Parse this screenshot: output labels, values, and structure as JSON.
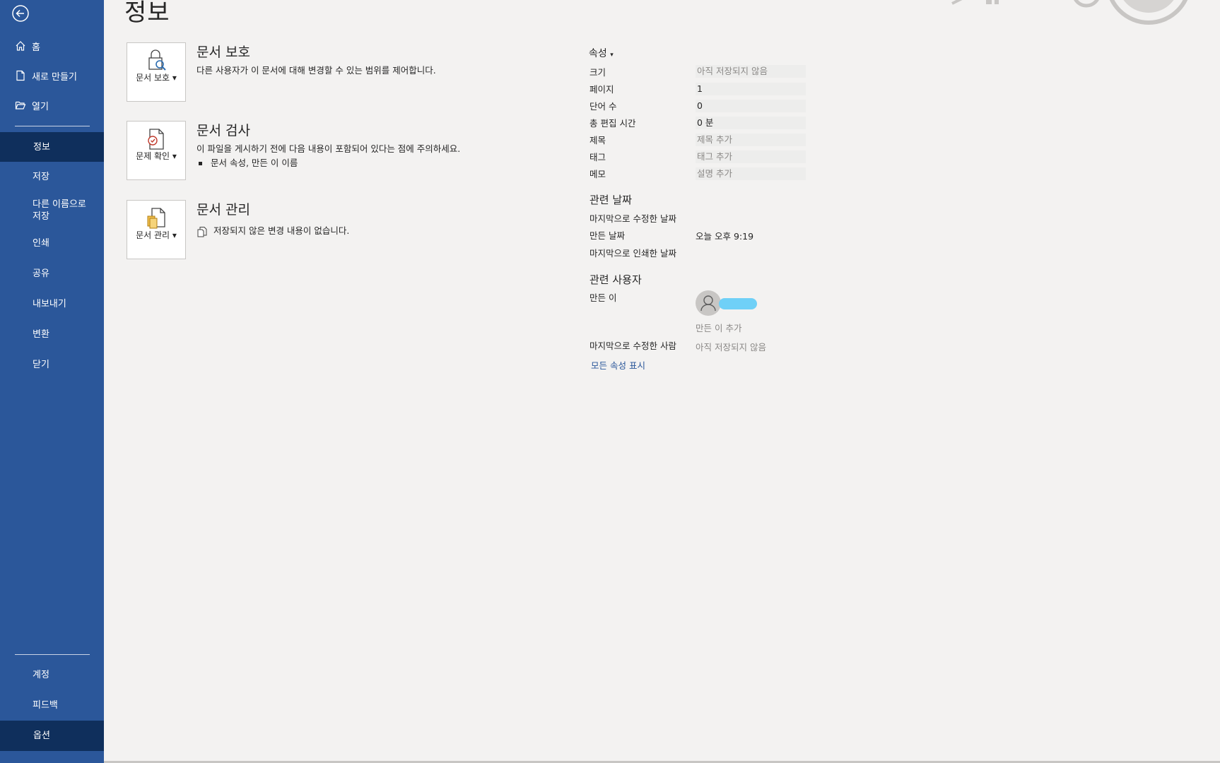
{
  "sidebar": {
    "top_items": [
      {
        "label": "홈",
        "icon": "home-icon"
      },
      {
        "label": "새로 만들기",
        "icon": "new-document-icon"
      },
      {
        "label": "열기",
        "icon": "open-folder-icon"
      }
    ],
    "items": [
      {
        "label": "정보",
        "selected": true
      },
      {
        "label": "저장"
      },
      {
        "label": "다른 이름으로 저장"
      },
      {
        "label": "인쇄"
      },
      {
        "label": "공유"
      },
      {
        "label": "내보내기"
      },
      {
        "label": "변환"
      },
      {
        "label": "닫기"
      }
    ],
    "bottom_items": [
      {
        "label": "계정"
      },
      {
        "label": "피드백"
      },
      {
        "label": "옵션",
        "selected": true
      }
    ],
    "colors": {
      "background": "#2b579a",
      "selected": "#0f2f5c"
    }
  },
  "main": {
    "title": "정보",
    "sections": [
      {
        "button_label": "문서 보호",
        "button_icon": "lock-document-icon",
        "title": "문서 보호",
        "description": "다른 사용자가 이 문서에 대해 변경할 수 있는 범위를 제어합니다."
      },
      {
        "button_label": "문제 확인",
        "button_icon": "check-document-icon",
        "title": "문서 검사",
        "description": "이 파일을 게시하기 전에 다음 내용이 포함되어 있다는 점에 주의하세요.",
        "bullets": [
          "문서 속성, 만든 이 이름"
        ]
      },
      {
        "button_label": "문서 관리",
        "button_icon": "manage-document-icon",
        "title": "문서 관리",
        "description": "저장되지 않은 변경 내용이 없습니다."
      }
    ]
  },
  "properties": {
    "header": "속성",
    "rows": [
      {
        "label": "크기",
        "value": "아직 저장되지 않음"
      },
      {
        "label": "페이지",
        "value": "1"
      },
      {
        "label": "단어 수",
        "value": "0"
      },
      {
        "label": "총 편집 시간",
        "value": "0 분"
      },
      {
        "label": "제목",
        "value": "제목 추가"
      },
      {
        "label": "태그",
        "value": "태그 추가"
      },
      {
        "label": "메모",
        "value": "설명 추가"
      }
    ],
    "dates_header": "관련 날짜",
    "dates": [
      {
        "label": "마지막으로 수정한 날짜",
        "value": ""
      },
      {
        "label": "만든 날짜",
        "value": "오늘 오후 9:19"
      },
      {
        "label": "마지막으로 인쇄한 날짜",
        "value": ""
      }
    ],
    "people_header": "관련 사용자",
    "author_label": "만든 이",
    "add_author": "만든 이 추가",
    "last_modified_by_label": "마지막으로 수정한 사람",
    "last_modified_by_value": "아직 저장되지 않음",
    "show_all": "모든 속성 표시"
  }
}
